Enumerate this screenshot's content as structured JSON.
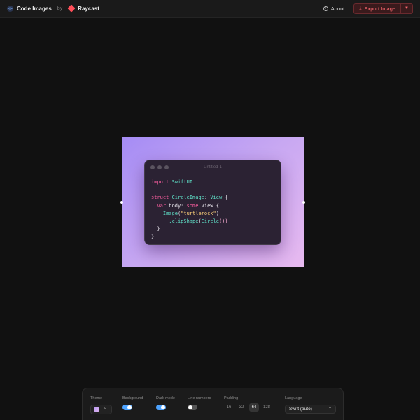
{
  "header": {
    "app_title": "Code Images",
    "by_label": "by",
    "partner": "Raycast",
    "about_label": "About",
    "export_label": "Export Image",
    "icons": {
      "logo": "code-brackets-icon",
      "partner": "raycast-icon",
      "about": "info-icon",
      "export": "download-icon",
      "dropdown": "chevron-down-icon"
    },
    "accent_color": "#ff6b73"
  },
  "editor": {
    "window_title": "Untitled-1",
    "background_gradient": [
      "#a58cf5",
      "#c8a8f2",
      "#e8baf0"
    ],
    "code_lines": [
      [
        {
          "t": "import",
          "c": "kw"
        },
        {
          "t": " ",
          "c": "pl"
        },
        {
          "t": "SwiftUI",
          "c": "ty"
        }
      ],
      [],
      [
        {
          "t": "struct",
          "c": "kw"
        },
        {
          "t": " ",
          "c": "pl"
        },
        {
          "t": "CircleImage",
          "c": "ty"
        },
        {
          "t": ": ",
          "c": "pl"
        },
        {
          "t": "View",
          "c": "ty"
        },
        {
          "t": " {",
          "c": "pl"
        }
      ],
      [
        {
          "t": "  ",
          "c": "pl"
        },
        {
          "t": "var",
          "c": "kw"
        },
        {
          "t": " body: ",
          "c": "pl"
        },
        {
          "t": "some",
          "c": "kw"
        },
        {
          "t": " View {",
          "c": "pl"
        }
      ],
      [
        {
          "t": "    ",
          "c": "pl"
        },
        {
          "t": "Image",
          "c": "ty"
        },
        {
          "t": "(",
          "c": "pl"
        },
        {
          "t": "\"turtlerock\"",
          "c": "st"
        },
        {
          "t": ")",
          "c": "pl"
        }
      ],
      [
        {
          "t": "      ",
          "c": "pl"
        },
        {
          "t": ".clipShape",
          "c": "ty"
        },
        {
          "t": "(",
          "c": "pl"
        },
        {
          "t": "Circle",
          "c": "ty"
        },
        {
          "t": "())",
          "c": "fn"
        }
      ],
      [
        {
          "t": "  }",
          "c": "pl"
        }
      ],
      [
        {
          "t": "}",
          "c": "pl"
        }
      ]
    ]
  },
  "controls": {
    "theme": {
      "label": "Theme",
      "icon": "chevron-up-icon"
    },
    "background": {
      "label": "Background",
      "on": true
    },
    "dark_mode": {
      "label": "Dark mode",
      "on": true
    },
    "line_numbers": {
      "label": "Line numbers",
      "on": false
    },
    "padding": {
      "label": "Padding",
      "options": [
        "16",
        "32",
        "64",
        "128"
      ],
      "selected": "64"
    },
    "language": {
      "label": "Language",
      "value": "Swift (auto)",
      "icon": "chevron-up-icon"
    }
  }
}
